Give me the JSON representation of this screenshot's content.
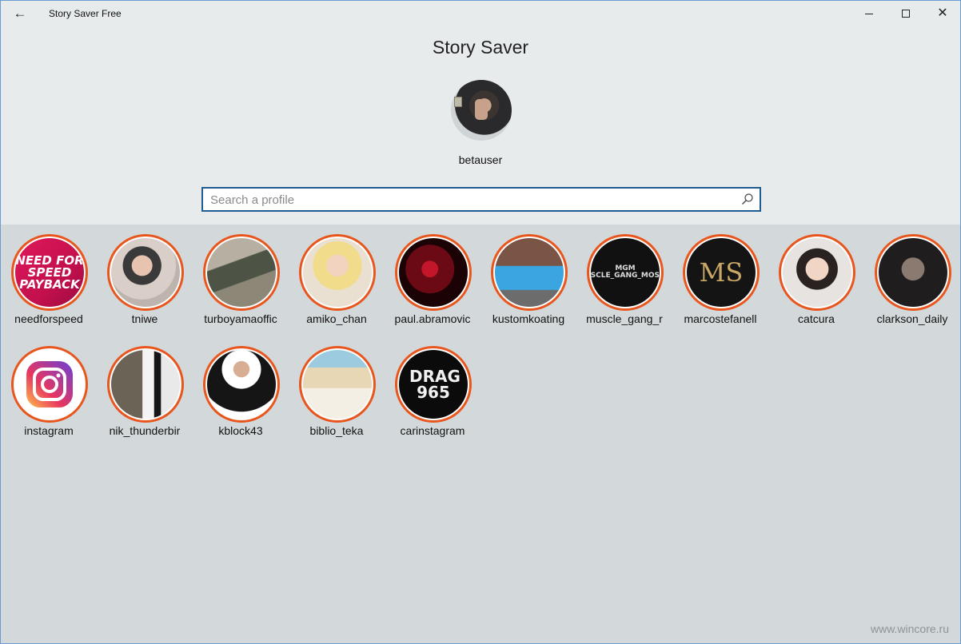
{
  "window": {
    "app_title": "Story Saver Free",
    "back_icon": "arrow-left-icon",
    "controls": [
      "minimize",
      "maximize",
      "close"
    ]
  },
  "header": {
    "page_title": "Story Saver",
    "username": "betauser"
  },
  "search": {
    "placeholder": "Search a profile",
    "value": ""
  },
  "profiles": [
    {
      "handle": "needforspeed",
      "picture_text": "NEED FOR SPEED PAYBACK"
    },
    {
      "handle": "tniwe"
    },
    {
      "handle": "turboyamaoffic"
    },
    {
      "handle": "amiko_chan"
    },
    {
      "handle": "paul.abramovic"
    },
    {
      "handle": "kustomkoating"
    },
    {
      "handle": "muscle_gang_r",
      "picture_text": "MGM #MUSCLE_GANG_MOSCOW"
    },
    {
      "handle": "marcostefanell",
      "picture_text": "MS"
    },
    {
      "handle": "catcura"
    },
    {
      "handle": "clarkson_daily"
    },
    {
      "handle": "instagram"
    },
    {
      "handle": "nik_thunderbir"
    },
    {
      "handle": "kblock43"
    },
    {
      "handle": "biblio_teka"
    },
    {
      "handle": "carinstagram",
      "picture_text": "DRAG 965"
    }
  ],
  "colors": {
    "ring": "#e8561e",
    "search_border": "#1f5c93",
    "header_bg": "#e8ebec",
    "grid_bg": "#d3d8da"
  },
  "watermark": "www.wincore.ru"
}
